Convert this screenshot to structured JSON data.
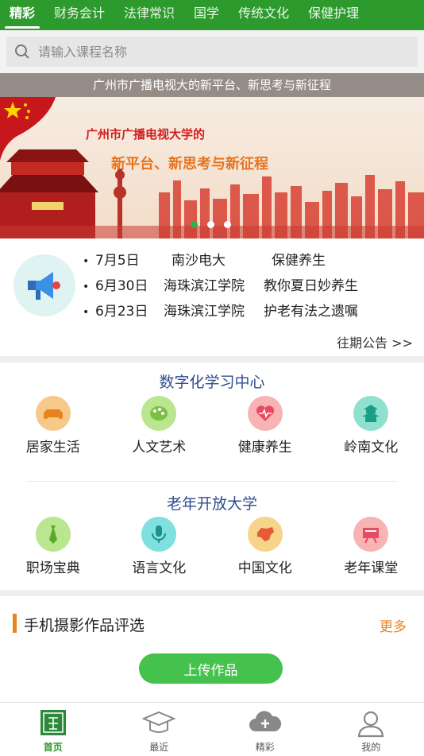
{
  "top_tabs": [
    "精彩",
    "财务会计",
    "法律常识",
    "国学",
    "传统文化",
    "保健护理"
  ],
  "search": {
    "placeholder": "请输入课程名称"
  },
  "banner": {
    "caption": "广州市广播电视大的新平台、新思考与新征程",
    "line1": "广州市广播电视大学的",
    "line2": "新平台、新思考与新征程"
  },
  "notices": [
    {
      "date": "7月5日",
      "school": "南沙电大",
      "topic": "保健养生"
    },
    {
      "date": "6月30日",
      "school": "海珠滨江学院",
      "topic": "教你夏日妙养生"
    },
    {
      "date": "6月23日",
      "school": "海珠滨江学院",
      "topic": "护老有法之遗嘱"
    }
  ],
  "past_link": "往期公告 >>",
  "digital_center": {
    "title": "数字化学习中心",
    "items": [
      {
        "label": "居家生活",
        "icon": "sofa-icon",
        "color": "#f6c98a"
      },
      {
        "label": "人文艺术",
        "icon": "palette-icon",
        "color": "#b9e68e"
      },
      {
        "label": "健康养生",
        "icon": "heart-pulse-icon",
        "color": "#f8b4b4"
      },
      {
        "label": "岭南文化",
        "icon": "pagoda-icon",
        "color": "#8fe0cf"
      }
    ]
  },
  "senior_university": {
    "title": "老年开放大学",
    "items": [
      {
        "label": "职场宝典",
        "icon": "tie-icon",
        "color": "#b9e68e"
      },
      {
        "label": "语言文化",
        "icon": "microphone-icon",
        "color": "#7fe0df"
      },
      {
        "label": "中国文化",
        "icon": "china-map-icon",
        "color": "#f6d48a"
      },
      {
        "label": "老年课堂",
        "icon": "blackboard-icon",
        "color": "#f8b4b4"
      }
    ]
  },
  "photo_section": {
    "title": "手机摄影作品评选",
    "more": "更多",
    "upload": "上传作品"
  },
  "bottom_tabs": [
    "首页",
    "最近",
    "精彩",
    "我的"
  ],
  "colors": {
    "brand_green": "#2d9a2d",
    "accent_orange": "#e8821e",
    "section_title_blue": "#2f4d8e"
  }
}
